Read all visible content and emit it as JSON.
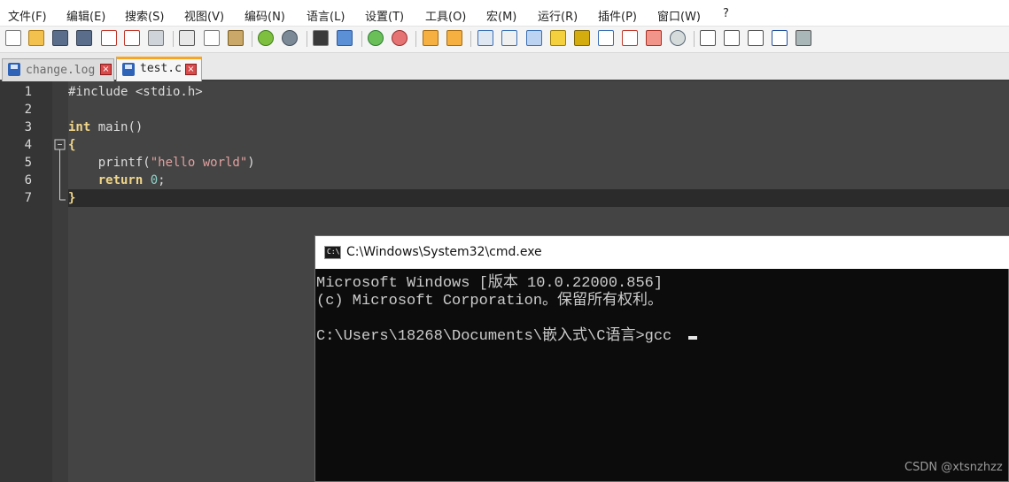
{
  "menu": [
    "文件(F)",
    "编辑(E)",
    "搜索(S)",
    "视图(V)",
    "编码(N)",
    "语言(L)",
    "设置(T)",
    "工具(O)",
    "宏(M)",
    "运行(R)",
    "插件(P)",
    "窗口(W)",
    "?"
  ],
  "toolbar": {
    "icons": [
      "new-file-icon",
      "open-file-icon",
      "save-icon",
      "save-all-icon",
      "close-icon",
      "close-all-icon",
      "print-icon",
      "cut-icon",
      "copy-icon",
      "paste-icon",
      "undo-icon",
      "redo-icon",
      "find-icon",
      "replace-icon",
      "zoom-in-icon",
      "zoom-out-icon",
      "sync-vertical-icon",
      "sync-horizontal-icon",
      "word-wrap-icon",
      "show-all-characters-icon",
      "indent-guide-icon",
      "udl-icon",
      "document-map-icon",
      "document-list-icon",
      "function-list-icon",
      "folder-workspace-icon",
      "monitoring-icon",
      "macro-record-icon",
      "macro-stop-icon",
      "macro-play-icon",
      "macro-run-multiple-icon",
      "macro-save-icon"
    ]
  },
  "tabs": [
    {
      "label": "change.log",
      "active": false
    },
    {
      "label": "test.c",
      "active": true
    }
  ],
  "editor": {
    "line_numbers": [
      "1",
      "2",
      "3",
      "4",
      "5",
      "6",
      "7"
    ],
    "current_line": 7
  },
  "cmd": {
    "title": "C:\\Windows\\System32\\cmd.exe",
    "icon_text": "C:\\",
    "lines": [
      "Microsoft Windows [版本 10.0.22000.856]",
      "(c) Microsoft Corporation。保留所有权利。",
      "",
      "C:\\Users\\18268\\Documents\\嵌入式\\C语言>gcc "
    ]
  },
  "watermark": "CSDN @xtsnzhzz",
  "colors": {
    "editor_bg": "#444444",
    "gutter_bg": "#353535",
    "current_line_bg": "#2b2b2b",
    "keyword": "#f0d68a",
    "string": "#e0a0a0",
    "number": "#8fd3c9",
    "cmd_bg": "#0c0c0c",
    "cmd_text": "#cccccc",
    "tab_active_accent": "#f6a623"
  }
}
